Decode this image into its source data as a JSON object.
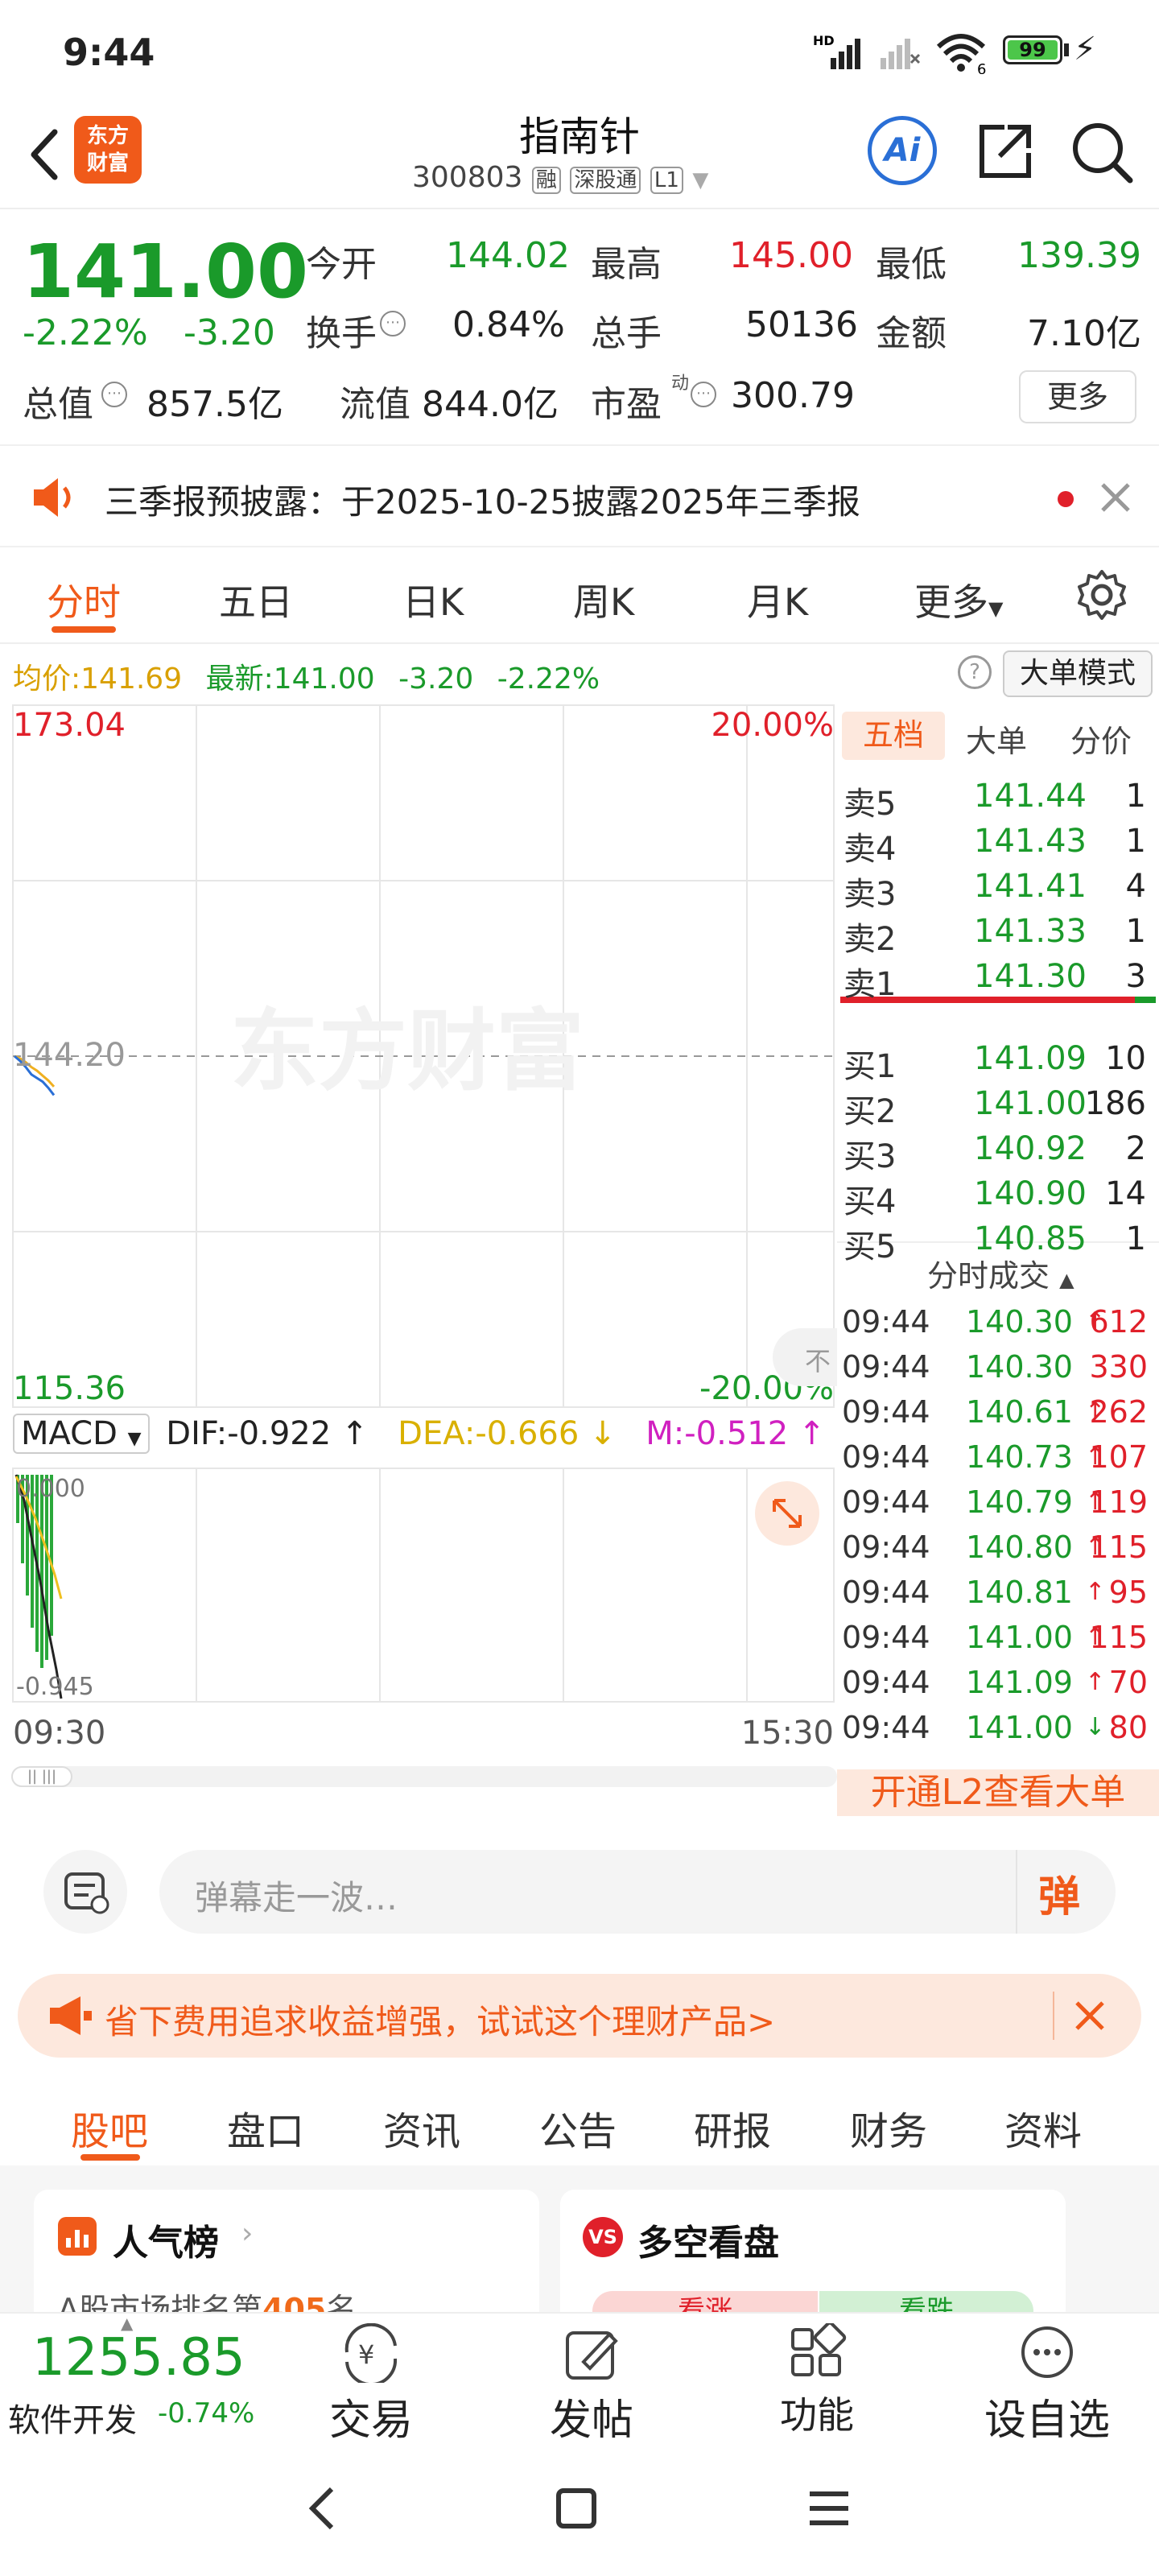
{
  "status_bar": {
    "time": "9:44",
    "battery": "99",
    "network_badge": "HD",
    "signal_sub": "6"
  },
  "header": {
    "back_icon": "chevron-left-icon",
    "app_logo": "东方财富",
    "stock_name": "指南针",
    "stock_code": "300803",
    "badges": [
      "融",
      "深股通",
      "L1"
    ],
    "ai_label": "Ai"
  },
  "quote": {
    "price": "141.00",
    "change_pct": "-2.22%",
    "change_amt": "-3.20",
    "open_label": "今开",
    "open": "144.02",
    "high_label": "最高",
    "high": "145.00",
    "low_label": "最低",
    "low": "139.39",
    "turnover_label": "换手",
    "turnover": "0.84%",
    "volume_label": "总手",
    "volume": "50136",
    "amount_label": "金额",
    "amount": "7.10亿",
    "mktcap_label": "总值",
    "mktcap": "857.5亿",
    "float_label": "流值",
    "float_cap": "844.0亿",
    "pe_label": "市盈",
    "pe_sup": "动",
    "pe": "300.79",
    "more_button": "更多"
  },
  "notice": {
    "text": "三季报预披露：于2025-10-25披露2025年三季报"
  },
  "chart_tabs": {
    "items": [
      "分时",
      "五日",
      "日K",
      "周K",
      "月K",
      "更多"
    ],
    "active": "分时"
  },
  "info_bar": {
    "avg_label": "均价:",
    "avg": "141.69",
    "latest_label": "最新:",
    "latest": "141.00",
    "chg": "-3.20",
    "chg_pct": "-2.22%",
    "mode_button": "大单模式"
  },
  "chart": {
    "y_top": "173.04",
    "y_top_pct": "20.00%",
    "y_mid": "144.20",
    "y_bottom": "115.36",
    "y_bottom_pct": "-20.00%",
    "watermark": "东方财富",
    "x_start": "09:30",
    "x_end": "15:30",
    "macd_label": "MACD",
    "dif": "DIF:-0.922 ↑",
    "dea": "DEA:-0.666 ↓",
    "m": "M:-0.512 ↑",
    "macd_top": "0.000",
    "macd_bottom": "-0.945",
    "side_hint": "不"
  },
  "chart_data": {
    "type": "line",
    "series": [
      {
        "name": "最新",
        "color": "#2a6fd6",
        "y": [
          144.2,
          143.8,
          143.3,
          142.7,
          142.4,
          142.1,
          141.6,
          141.0
        ]
      },
      {
        "name": "均价",
        "color": "#f0b020",
        "y": [
          144.2,
          144.0,
          143.7,
          143.3,
          143.0,
          142.6,
          142.2,
          141.69
        ]
      }
    ],
    "ylim": [
      115.36,
      173.04
    ],
    "ref_line": 144.2,
    "macd": {
      "dif": -0.922,
      "dea": -0.666,
      "m": -0.512,
      "range": [
        -0.945,
        0.0
      ]
    }
  },
  "order_book": {
    "tabs": [
      "五档",
      "大单",
      "分价"
    ],
    "asks": [
      {
        "label": "卖5",
        "price": "141.44",
        "vol": "1"
      },
      {
        "label": "卖4",
        "price": "141.43",
        "vol": "1"
      },
      {
        "label": "卖3",
        "price": "141.41",
        "vol": "4"
      },
      {
        "label": "卖2",
        "price": "141.33",
        "vol": "1"
      },
      {
        "label": "卖1",
        "price": "141.30",
        "vol": "3"
      }
    ],
    "bids": [
      {
        "label": "买1",
        "price": "141.09",
        "vol": "10"
      },
      {
        "label": "买2",
        "price": "141.00",
        "vol": "186"
      },
      {
        "label": "买3",
        "price": "140.92",
        "vol": "2"
      },
      {
        "label": "买4",
        "price": "140.90",
        "vol": "14"
      },
      {
        "label": "买5",
        "price": "140.85",
        "vol": "1"
      }
    ],
    "trades_title": "分时成交",
    "trades": [
      {
        "t": "09:44",
        "p": "140.30",
        "a": "↑",
        "v": "612"
      },
      {
        "t": "09:44",
        "p": "140.30",
        "a": "",
        "v": "330"
      },
      {
        "t": "09:44",
        "p": "140.61",
        "a": "↑",
        "v": "262"
      },
      {
        "t": "09:44",
        "p": "140.73",
        "a": "↑",
        "v": "107"
      },
      {
        "t": "09:44",
        "p": "140.79",
        "a": "↑",
        "v": "119"
      },
      {
        "t": "09:44",
        "p": "140.80",
        "a": "↑",
        "v": "115"
      },
      {
        "t": "09:44",
        "p": "140.81",
        "a": "↑",
        "v": "95"
      },
      {
        "t": "09:44",
        "p": "141.00",
        "a": "↑",
        "v": "115"
      },
      {
        "t": "09:44",
        "p": "141.09",
        "a": "↑",
        "v": "70"
      },
      {
        "t": "09:44",
        "p": "141.00",
        "a": "↓",
        "v": "80"
      }
    ],
    "l2_button": "开通L2查看大单"
  },
  "danmu": {
    "placeholder": "弹幕走一波…",
    "send_label": "弹"
  },
  "promo": {
    "text": "省下费用追求收益增强，试试这个理财产品>"
  },
  "sub_tabs": {
    "items": [
      "股吧",
      "盘口",
      "资讯",
      "公告",
      "研报",
      "财务",
      "资料"
    ],
    "active": "股吧"
  },
  "cards": {
    "popularity_title": "人气榜",
    "popularity_text_prefix": "A股市场排名第",
    "popularity_rank": "405",
    "popularity_text_suffix": "名",
    "duokong_title": "多空看盘",
    "bull": "看涨",
    "bear": "看跌"
  },
  "bottom_bar": {
    "index_value": "1255.85",
    "index_name": "软件开发",
    "index_chg": "-0.74%",
    "items": [
      "交易",
      "发帖",
      "功能",
      "设自选"
    ]
  }
}
